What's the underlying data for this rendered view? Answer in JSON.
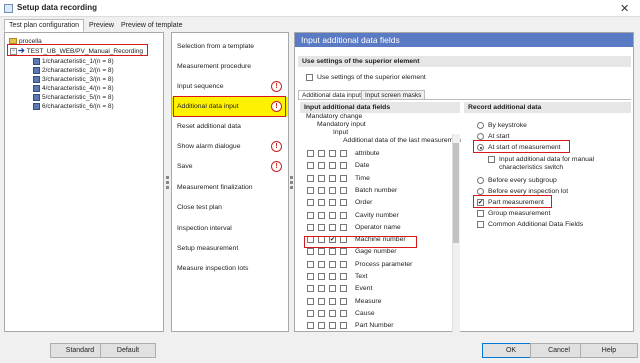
{
  "window": {
    "title": "Setup data recording",
    "close_glyph": "✕"
  },
  "top_tabs": [
    "Test plan configuration",
    "Preview",
    "Preview of template"
  ],
  "tree": {
    "root": "procella",
    "plan": "TEST_UB_WEB/PV_Manual_Recording",
    "children": [
      "1/characteristic_1/(n = 8)",
      "2/characteristic_2/(n = 8)",
      "3/characteristic_3/(n = 8)",
      "4/characteristic_4/(n = 8)",
      "5/characteristic_5/(n = 8)",
      "6/characteristic_6/(n = 8)"
    ]
  },
  "steps": [
    "Selection from a template",
    "Measurement procedure",
    "Input sequence",
    "Additional data input",
    "Reset additional data",
    "Show alarm dialogue",
    "Save",
    "Measurement finalization",
    "Close test plan",
    "Inspection interval",
    "Setup measurement",
    "Measure inspection lots"
  ],
  "warning_glyph": "!",
  "right": {
    "header": "Input additional data fields",
    "superior_section": "Use settings of the superior element",
    "superior_checkbox": "Use settings of the superior element",
    "inner_tabs": [
      "Additional data input",
      "Input screen masks"
    ],
    "fields_section": "Input additional data fields",
    "column_headers": [
      "Mandatory change",
      "Mandatory input",
      "Input",
      "Additional data of the last measurement (s"
    ],
    "fields": [
      "attribute",
      "Date",
      "Time",
      "Batch number",
      "Order",
      "Cavity number",
      "Operator name",
      "Machine number",
      "Gage number",
      "Process parameter",
      "Text",
      "Event",
      "Measure",
      "Cause",
      "Part Number"
    ],
    "record_section": "Record additional data",
    "record_radios": [
      "By keystroke",
      "At start",
      "At start of measurement"
    ],
    "manual_switch_line1": "Input additional data for manual",
    "manual_switch_line2": "characteristics switch",
    "record_radios2": [
      "Before every subgroup",
      "Before every inspection lot"
    ],
    "record_checks": [
      "Part measurement",
      "Group measurement",
      "Common Additional Data Fields"
    ]
  },
  "buttons": {
    "standard": "Standard",
    "default": "Default",
    "ok": "OK",
    "cancel": "Cancel",
    "help": "Help"
  }
}
